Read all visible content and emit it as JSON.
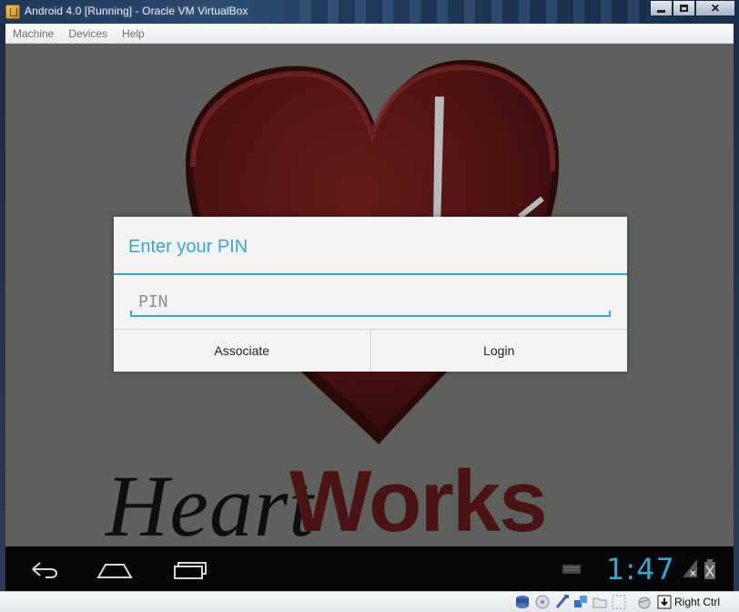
{
  "window": {
    "title": "Android 4.0 [Running] - Oracle VM VirtualBox"
  },
  "menubar": {
    "items": [
      "Machine",
      "Devices",
      "Help"
    ]
  },
  "background": {
    "logo_word_1": "Heart",
    "logo_word_2": "Works",
    "heart_color": "#5a1616",
    "screen_color": "#5d605d"
  },
  "dialog": {
    "title": "Enter your PIN",
    "pin_placeholder": "PIN",
    "pin_value": "",
    "associate_label": "Associate",
    "login_label": "Login",
    "accent_color": "#35a7d4"
  },
  "navbar": {
    "clock": "1:47"
  },
  "statusbar": {
    "host_key_label": "Right Ctrl"
  }
}
